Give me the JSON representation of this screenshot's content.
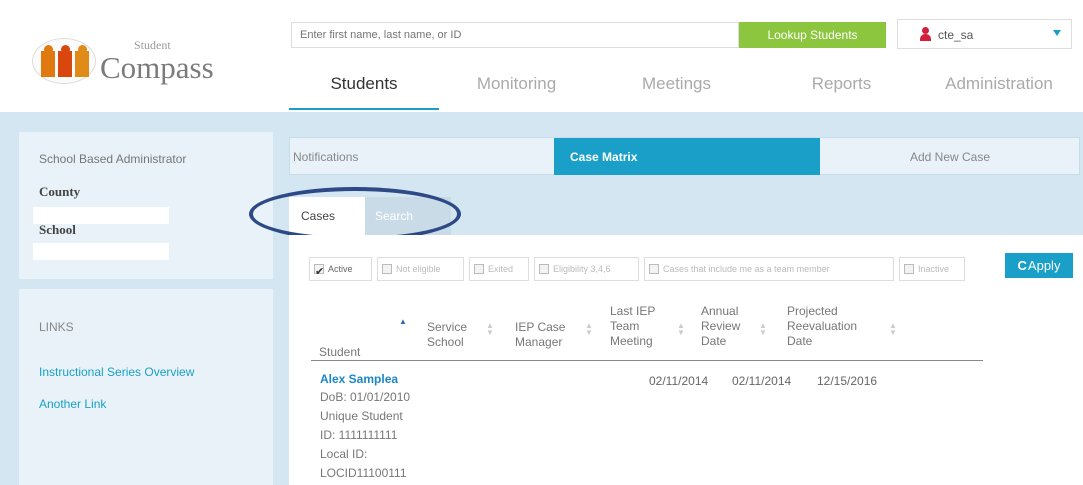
{
  "app": {
    "logo_small": "Student",
    "logo_big": "Compass"
  },
  "search": {
    "placeholder": "Enter first name, last name, or ID",
    "button": "Lookup Students"
  },
  "user": {
    "name": "cte_sa"
  },
  "nav": {
    "tabs": [
      "Students",
      "Monitoring",
      "Meetings",
      "Reports",
      "Administration"
    ]
  },
  "sidebar": {
    "role": "School Based Administrator",
    "county_label": "County",
    "school_label": "School",
    "links_title": "LINKS",
    "links": [
      "Instructional Series Overview",
      "Another Link"
    ]
  },
  "subtabs": [
    "Notifications",
    "Case Matrix",
    "Add New Case"
  ],
  "case_tabs": {
    "cases": "Cases",
    "search": "Search"
  },
  "filters": [
    "Active",
    "Not eligible",
    "Exited",
    "Eligibility 3,4,6",
    "Cases that include me as a team member",
    "Inactive"
  ],
  "apply": {
    "symbol": "C",
    "label": "Apply"
  },
  "table": {
    "headers": {
      "student": "Student",
      "service_school": [
        "Service",
        "School"
      ],
      "iep_manager": [
        "IEP Case",
        "Manager"
      ],
      "last_iep": [
        "Last IEP",
        "Team",
        "Meeting"
      ],
      "annual": [
        "Annual",
        "Review",
        "Date"
      ],
      "projected": [
        "Projected",
        "Reevaluation",
        "Date"
      ]
    },
    "row": {
      "name": "Alex Samplea",
      "dob": "DoB: 01/01/2010",
      "unique1": "Unique Student",
      "unique2": "ID: 1111111111",
      "local1": "Local ID:",
      "local2": "LOCID11100111",
      "last_iep": "02/11/2014",
      "annual": "02/11/2014",
      "projected": "12/15/2016"
    }
  },
  "colors": {
    "accent": "#1aa0c8",
    "lookup": "#8cc63f",
    "annotation": "#2d4a86"
  }
}
